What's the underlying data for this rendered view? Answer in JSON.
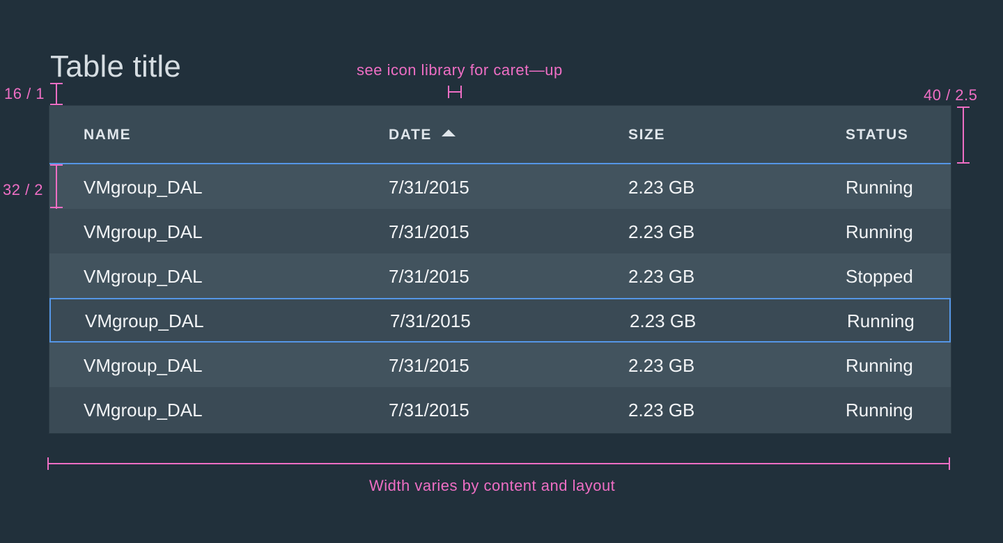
{
  "table": {
    "title": "Table title",
    "columns": [
      {
        "label": "NAME"
      },
      {
        "label": "DATE",
        "sort": "ascending",
        "sort_icon": "caret-up-icon"
      },
      {
        "label": "SIZE"
      },
      {
        "label": "STATUS"
      }
    ],
    "rows": [
      {
        "name": "VMgroup_DAL",
        "date": "7/31/2015",
        "size": "2.23 GB",
        "status": "Running"
      },
      {
        "name": "VMgroup_DAL",
        "date": "7/31/2015",
        "size": "2.23 GB",
        "status": "Running"
      },
      {
        "name": "VMgroup_DAL",
        "date": "7/31/2015",
        "size": "2.23 GB",
        "status": "Stopped"
      },
      {
        "name": "VMgroup_DAL",
        "date": "7/31/2015",
        "size": "2.23 GB",
        "status": "Running",
        "selected": true
      },
      {
        "name": "VMgroup_DAL",
        "date": "7/31/2015",
        "size": "2.23 GB",
        "status": "Running"
      },
      {
        "name": "VMgroup_DAL",
        "date": "7/31/2015",
        "size": "2.23 GB",
        "status": "Running"
      }
    ]
  },
  "annotations": {
    "icon_note": "see icon library for caret—up",
    "title_spacing": "16 / 1",
    "header_height": "40 / 2.5",
    "row_height": "32 / 2",
    "width_note": "Width varies by content and layout"
  },
  "colors": {
    "background": "#21303b",
    "header": "#394a55",
    "row_odd": "#42535e",
    "row_even": "#3a4a55",
    "accent": "#5596e6",
    "annotation": "#ee6ec4"
  }
}
